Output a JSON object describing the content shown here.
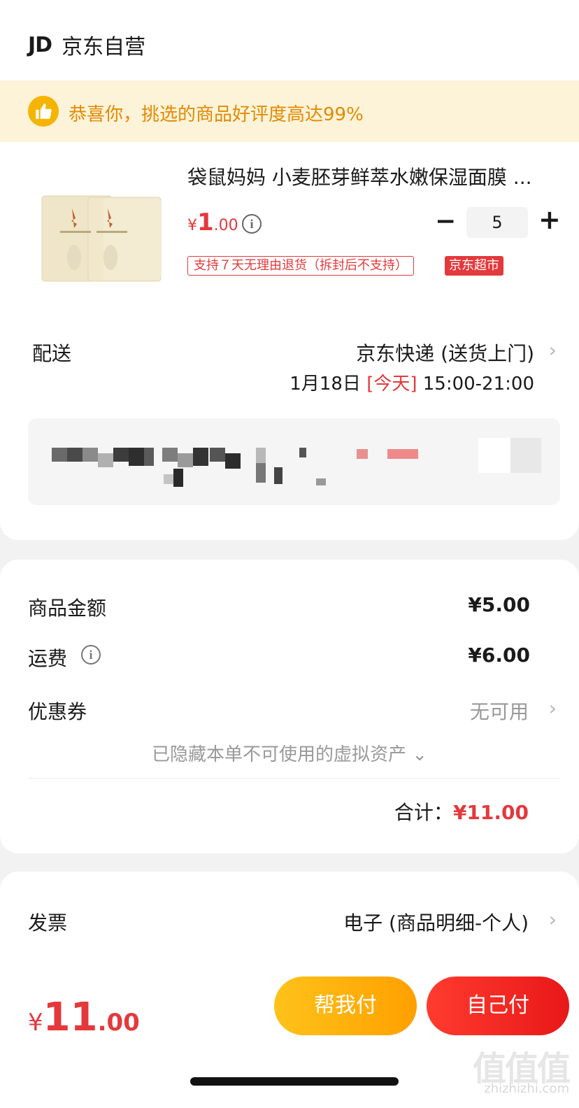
{
  "store": {
    "logo": "JD",
    "name": "京东自营"
  },
  "banner": {
    "icon": "thumbs-up-icon",
    "text": "恭喜你，挑选的商品好评度高达",
    "percent": "99%"
  },
  "product": {
    "title": "袋鼠妈妈 小麦胚芽鲜萃水嫩保湿面膜 ...",
    "price_symbol": "¥",
    "price_int": "1",
    "price_dec": ".00",
    "quantity": "5",
    "minus": "−",
    "plus": "+",
    "tag_return": "支持７天无理由退货（拆封后不支持）",
    "tag_store": "京东超市"
  },
  "delivery": {
    "label": "配送",
    "method": "京东快递 (送货上门)",
    "date": "1月18日",
    "today": "[今天]",
    "time": "15:00-21:00"
  },
  "summary": {
    "goods_label": "商品金额",
    "goods_value": "¥5.00",
    "freight_label": "运费",
    "freight_value": "¥6.00",
    "coupon_label": "优惠券",
    "coupon_value": "无可用",
    "hidden_note": "已隐藏本单不可使用的虚拟资产 ⌄",
    "total_label": "合计：",
    "total_value": "¥11.00"
  },
  "invoice": {
    "label": "发票",
    "value": "电子 (商品明细-个人)"
  },
  "bottom": {
    "price_symbol": "¥",
    "price_int": "11",
    "price_dec": ".00",
    "help_pay": "帮我付",
    "self_pay": "自己付"
  },
  "watermark": {
    "main": "值值值",
    "sub": "zhizhizhi.com"
  },
  "colors": {
    "accent_red": "#e4393c",
    "banner_bg": "#fdf3d9",
    "banner_text": "#e38a00",
    "help_pay": "#ffb000",
    "self_pay": "#f02a20"
  }
}
